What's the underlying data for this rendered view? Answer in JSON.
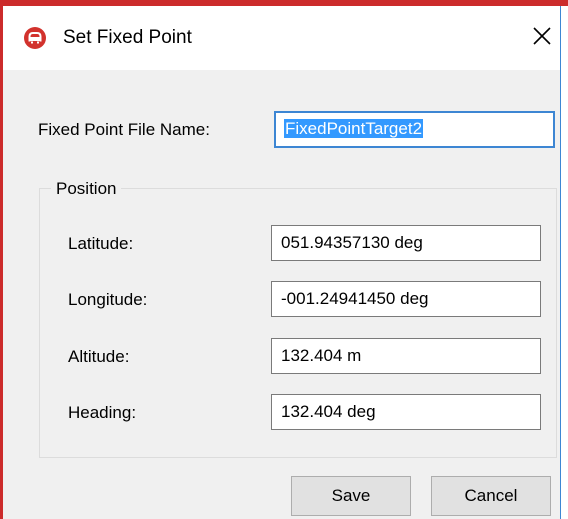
{
  "window": {
    "title": "Set Fixed Point",
    "app_icon": "car-logo-icon",
    "close_icon": "close-icon"
  },
  "file": {
    "label": "Fixed Point File Name:",
    "value": "FixedPointTarget2"
  },
  "position": {
    "group_label": "Position",
    "fields": [
      {
        "label": "Latitude:",
        "value": "051.94357130 deg"
      },
      {
        "label": "Longitude:",
        "value": "-001.24941450 deg"
      },
      {
        "label": "Altitude:",
        "value": "132.404 m"
      },
      {
        "label": "Heading:",
        "value": "132.404 deg"
      }
    ]
  },
  "buttons": {
    "save": "Save",
    "cancel": "Cancel"
  },
  "colors": {
    "accent": "#cc2b2b",
    "focus_border": "#3d86d3",
    "selection": "#3399ff"
  }
}
